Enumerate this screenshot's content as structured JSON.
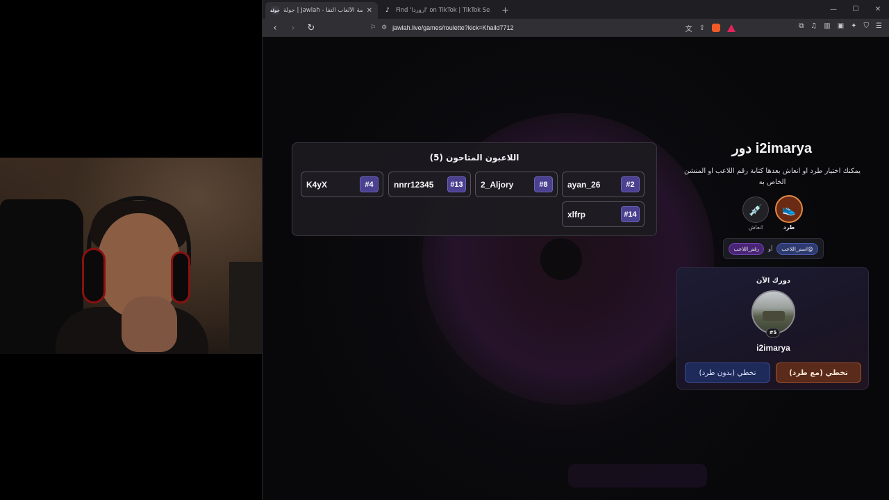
{
  "browser": {
    "tabs": [
      {
        "label": "جولة | Jawlah - منصة الألعاب التفا",
        "favicon": "جولة",
        "active": true
      },
      {
        "label": "Find 'اروردا' on TikTok | TikTok Search",
        "favicon": "tiktok-icon",
        "active": false
      }
    ],
    "new_tab": "+",
    "url": "jawlah.live/games/roulette?kick=Khaild7712"
  },
  "players": {
    "title": "اللاعبون المتاحون (5)",
    "list": [
      {
        "name": "ayan_26",
        "number": "#2"
      },
      {
        "name": "2_Aljory",
        "number": "#8"
      },
      {
        "name": "nnrr12345",
        "number": "#13"
      },
      {
        "name": "K4yX",
        "number": "#4"
      },
      {
        "name": "xlfrp",
        "number": "#14"
      }
    ]
  },
  "turn": {
    "title": "دور i2imarya",
    "description": "يمكنك اختيار طرد او انعاش بعدها كتابة رقم اللاعب او المنشن الخاص به",
    "kick_label": "طرد",
    "revive_label": "انعاش",
    "hint_name": "@اسم_اللاعب",
    "hint_or": "أو",
    "hint_number": "رقم_اللاعب"
  },
  "current": {
    "label": "دورك الآن",
    "badge": "#5",
    "name": "i2imarya",
    "btn_with_kick": "تخطي (مع طرد)",
    "btn_no_kick": "تخطي (بدون طرد)"
  },
  "colors": {
    "accent_purple": "#4a4191",
    "kick_orange": "#e08a45",
    "skip_blue": "#1e2a5a"
  }
}
